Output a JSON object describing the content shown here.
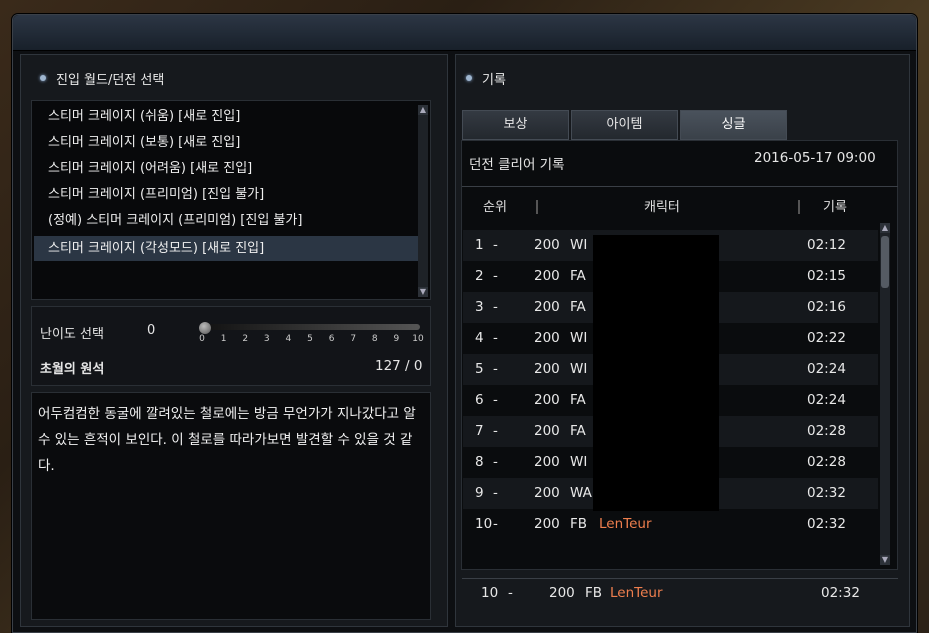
{
  "left": {
    "header": "진입 월드/던전 선택",
    "dungeons": [
      "스티머 크레이지 (쉬움) [새로 진입]",
      "스티머 크레이지 (보통) [새로 진입]",
      "스티머 크레이지 (어려움) [새로 진입]",
      "스티머 크레이지 (프리미엄) [진입 불가]",
      "(정예) 스티머 크레이지 (프리미엄) [진입 불가]",
      "스티머 크레이지 (각성모드) [새로 진입]"
    ],
    "selected_index": 5,
    "difficulty_label": "난이도 선택",
    "difficulty_value": "0",
    "slider_ticks": [
      "0",
      "1",
      "2",
      "3",
      "4",
      "5",
      "6",
      "7",
      "8",
      "9",
      "10"
    ],
    "slider_value_fraction": 0,
    "stone_label": "초월의 원석",
    "stone_value": "127 / 0",
    "description": "어두컴컴한 동굴에 깔려있는 철로에는 방금 무언가가 지나갔다고 알 수 있는 흔적이 보인다. 이 철로를 따라가보면 발견할 수 있을 것 같다."
  },
  "right": {
    "header": "기록",
    "tabs": [
      "보상",
      "아이템",
      "싱글"
    ],
    "active_tab": 2,
    "subtitle": "던전 클리어 기록",
    "date": "2016-05-17 09:00",
    "columns": [
      "순위",
      "캐릭터",
      "기록"
    ],
    "rows": [
      {
        "rank": "1",
        "dash": "-",
        "level": "200",
        "cls": "WI",
        "name": "",
        "time": "02:12"
      },
      {
        "rank": "2",
        "dash": "-",
        "level": "200",
        "cls": "FA",
        "name": "",
        "time": "02:15"
      },
      {
        "rank": "3",
        "dash": "-",
        "level": "200",
        "cls": "FA",
        "name": "",
        "time": "02:16"
      },
      {
        "rank": "4",
        "dash": "-",
        "level": "200",
        "cls": "WI",
        "name": "",
        "time": "02:22"
      },
      {
        "rank": "5",
        "dash": "-",
        "level": "200",
        "cls": "WI",
        "name": "",
        "time": "02:24"
      },
      {
        "rank": "6",
        "dash": "-",
        "level": "200",
        "cls": "FA",
        "name": "",
        "time": "02:24"
      },
      {
        "rank": "7",
        "dash": "-",
        "level": "200",
        "cls": "FA",
        "name": "",
        "time": "02:28"
      },
      {
        "rank": "8",
        "dash": "-",
        "level": "200",
        "cls": "WI",
        "name": "",
        "time": "02:28"
      },
      {
        "rank": "9",
        "dash": "-",
        "level": "200",
        "cls": "WA",
        "name": "",
        "time": "02:32"
      },
      {
        "rank": "10",
        "dash": "-",
        "level": "200",
        "cls": "FB",
        "name": "LenTeur",
        "time": "02:32"
      }
    ],
    "my_record": {
      "rank": "10",
      "dash": "-",
      "level": "200",
      "cls": "FB",
      "name": "LenTeur",
      "time": "02:32"
    }
  },
  "colors": {
    "highlight_name": "#ef7f4e",
    "selected_row": "#2b3644"
  }
}
